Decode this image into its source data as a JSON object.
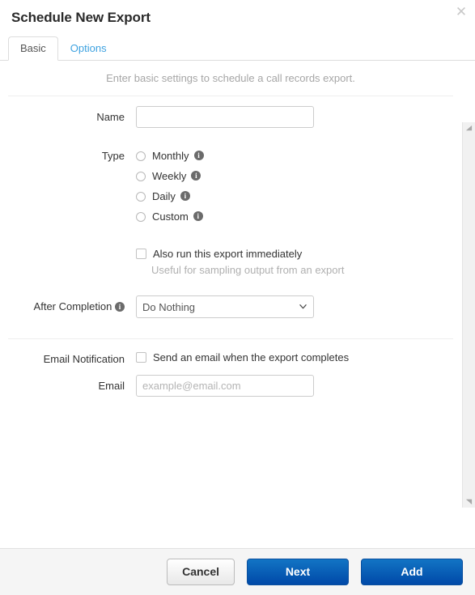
{
  "dialog": {
    "title": "Schedule New Export",
    "close_icon": "close-icon"
  },
  "tabs": [
    {
      "label": "Basic",
      "active": true
    },
    {
      "label": "Options",
      "active": false
    }
  ],
  "body": {
    "intro": "Enter basic settings to schedule a call records export.",
    "fields": {
      "name": {
        "label": "Name",
        "value": "",
        "placeholder": ""
      },
      "type": {
        "label": "Type",
        "options": [
          {
            "label": "Monthly",
            "selected": false,
            "info": "info-icon"
          },
          {
            "label": "Weekly",
            "selected": false,
            "info": "info-icon"
          },
          {
            "label": "Daily",
            "selected": false,
            "info": "info-icon"
          },
          {
            "label": "Custom",
            "selected": false,
            "info": "info-icon"
          }
        ]
      },
      "run_immediately": {
        "label": "Also run this export immediately",
        "checked": false,
        "help": "Useful for sampling output from an export"
      },
      "after_completion": {
        "label": "After Completion",
        "info": "info-icon",
        "value": "Do Nothing",
        "options": [
          "Do Nothing"
        ]
      },
      "email_notification": {
        "label": "Email Notification",
        "checkbox_label": "Send an email when the export completes",
        "checked": false
      },
      "email": {
        "label": "Email",
        "value": "",
        "placeholder": "example@email.com"
      }
    }
  },
  "footer": {
    "cancel_label": "Cancel",
    "next_label": "Next",
    "add_label": "Add"
  },
  "colors": {
    "accent_blue": "#0049a8",
    "link_blue": "#3ea2e0",
    "muted_text": "#a6a6a6",
    "border": "#dddddd",
    "footer_bg": "#f5f5f5"
  }
}
